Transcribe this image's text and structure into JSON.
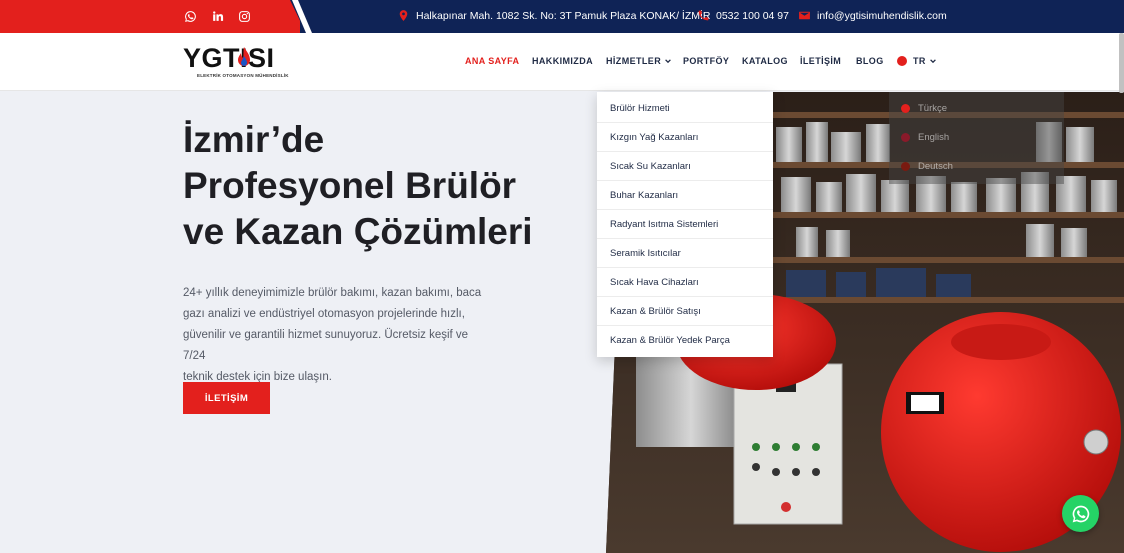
{
  "topbar": {
    "address": "Halkapınar Mah. 1082 Sk. No: 3T Pamuk Plaza KONAK/ İZMİR",
    "phone": "0532 100 04 97",
    "email": "info@ygtisimuhendislik.com"
  },
  "logo": {
    "text": "YGTISI",
    "subtitle": "ELEKTRİK OTOMASYON MÜHENDİSLİK"
  },
  "nav": {
    "items": [
      {
        "label": "ANA SAYFA",
        "active": true
      },
      {
        "label": "HAKKIMIZDA"
      },
      {
        "label": "HİZMETLER"
      },
      {
        "label": "PORTFÖY"
      },
      {
        "label": "KATALOG"
      },
      {
        "label": "İLETİŞİM"
      },
      {
        "label": "BLOG"
      }
    ],
    "lang": "TR"
  },
  "services_menu": [
    "Brülör Hizmeti",
    "Kızgın Yağ Kazanları",
    "Sıcak Su Kazanları",
    "Buhar Kazanları",
    "Radyant Isıtma Sistemleri",
    "Seramik Isıtıcılar",
    "Sıcak Hava Cihazları",
    "Kazan & Brülör Satışı",
    "Kazan & Brülör Yedek Parça"
  ],
  "lang_menu": [
    "Türkçe",
    "English",
    "Deutsch"
  ],
  "hero": {
    "title_line1": "İzmir’de",
    "title_line2": "Profesyonel Brülör",
    "title_line3": "ve Kazan Çözümleri",
    "desc_line1": "24+ yıllık deneyimimizle brülör bakımı, kazan bakımı, baca",
    "desc_line2": "gazı analizi ve endüstriyel otomasyon projelerinde hızlı,",
    "desc_line3": "güvenilir ve garantili hizmet sunuyoruz. Ücretsiz keşif ve 7/24",
    "desc_line4": "teknik destek için bize ulaşın.",
    "button": "İLETİŞİM"
  },
  "colors": {
    "brand_red": "#e3201d",
    "navy": "#0f2356",
    "whatsapp": "#25d366"
  },
  "icons": {
    "social": [
      "whatsapp-icon",
      "linkedin-icon",
      "instagram-icon"
    ],
    "contact": [
      "location-pin-icon",
      "phone-icon",
      "mail-icon"
    ]
  }
}
